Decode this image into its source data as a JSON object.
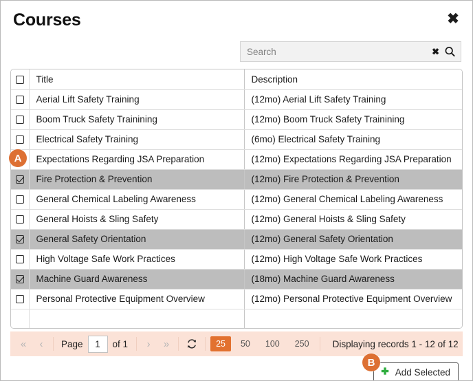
{
  "dialog": {
    "title": "Courses",
    "close_icon": "close-icon"
  },
  "search": {
    "placeholder": "Search",
    "value": "",
    "clear_icon": "clear-icon",
    "submit_icon": "search-icon"
  },
  "table": {
    "columns": [
      "",
      "Title",
      "Description"
    ],
    "header_checkbox_checked": false,
    "rows": [
      {
        "checked": false,
        "selected": false,
        "title": "Aerial Lift Safety Training",
        "description": "(12mo) Aerial Lift Safety Training"
      },
      {
        "checked": false,
        "selected": false,
        "title": "Boom Truck Safety Trainining",
        "description": "(12mo) Boom Truck Safety Trainining"
      },
      {
        "checked": false,
        "selected": false,
        "title": "Electrical Safety Training",
        "description": "(6mo) Electrical Safety Training"
      },
      {
        "checked": false,
        "selected": false,
        "title": "Expectations Regarding JSA Preparation",
        "description": "(12mo) Expectations Regarding JSA Preparation"
      },
      {
        "checked": true,
        "selected": true,
        "title": "Fire Protection & Prevention",
        "description": "(12mo) Fire Protection & Prevention"
      },
      {
        "checked": false,
        "selected": false,
        "title": "General Chemical Labeling Awareness",
        "description": "(12mo) General Chemical Labeling Awareness"
      },
      {
        "checked": false,
        "selected": false,
        "title": "General Hoists & Sling Safety",
        "description": "(12mo) General Hoists & Sling Safety"
      },
      {
        "checked": true,
        "selected": true,
        "title": "General Safety Orientation",
        "description": "(12mo) General Safety Orientation"
      },
      {
        "checked": false,
        "selected": false,
        "title": "High Voltage Safe Work Practices",
        "description": "(12mo) High Voltage Safe Work Practices"
      },
      {
        "checked": true,
        "selected": true,
        "title": "Machine Guard Awareness",
        "description": "(18mo) Machine Guard Awareness"
      },
      {
        "checked": false,
        "selected": false,
        "title": "Personal Protective Equipment Overview",
        "description": "(12mo) Personal Protective Equipment Overview"
      }
    ]
  },
  "pager": {
    "first_icon": "«",
    "prev_icon": "‹",
    "page_label": "Page",
    "page_value": "1",
    "of_label": "of 1",
    "next_icon": "›",
    "last_icon": "»",
    "refresh_icon": "refresh-icon",
    "page_sizes": [
      "25",
      "50",
      "100",
      "250"
    ],
    "active_page_size": "25",
    "status": "Displaying records 1 - 12 of 12"
  },
  "actions": {
    "add_selected_label": "Add Selected",
    "add_icon": "plus-icon"
  },
  "annotations": [
    {
      "id": "A",
      "label": "A"
    },
    {
      "id": "B",
      "label": "B"
    }
  ],
  "colors": {
    "accent_orange": "#e2712f",
    "badge_orange": "#dd7033",
    "pager_bg": "#fbe2d7",
    "row_selected": "#bdbdbd",
    "plus_green": "#2fad3f"
  }
}
